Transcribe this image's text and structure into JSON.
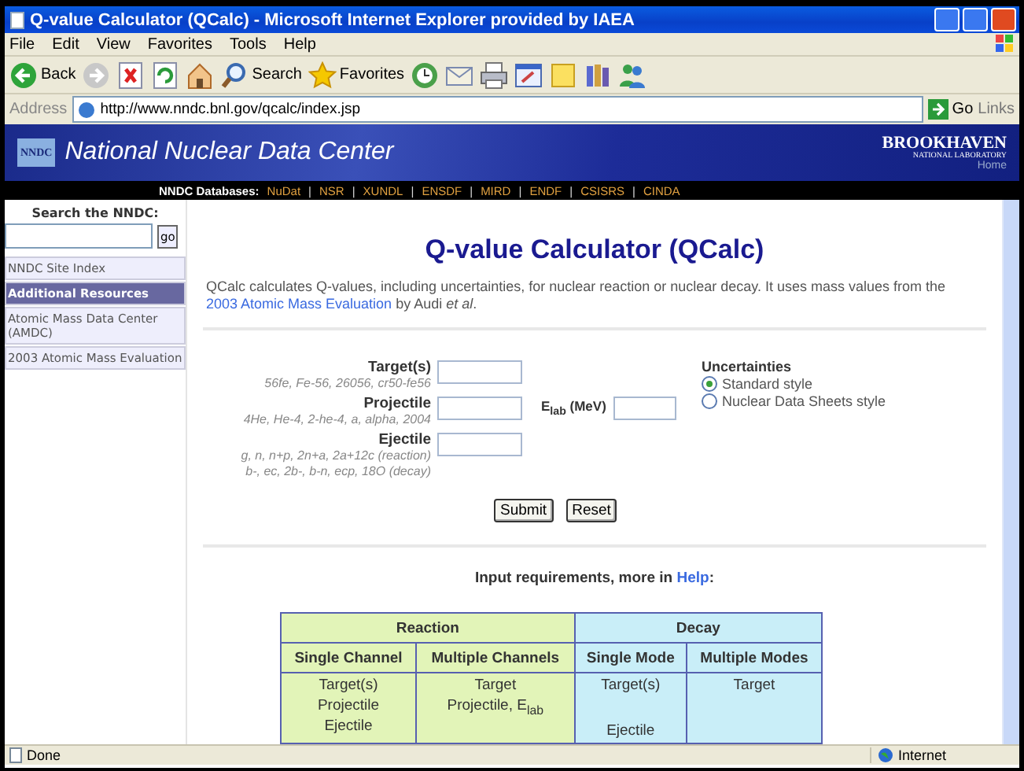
{
  "window": {
    "title": "Q-value Calculator (QCalc) - Microsoft Internet Explorer provided by IAEA",
    "menu": [
      "File",
      "Edit",
      "View",
      "Favorites",
      "Tools",
      "Help"
    ],
    "toolbar": [
      {
        "kind": "back",
        "label": "Back"
      },
      {
        "kind": "forward"
      },
      {
        "kind": "stop"
      },
      {
        "kind": "refresh"
      },
      {
        "kind": "home"
      },
      {
        "kind": "search",
        "label": "Search"
      },
      {
        "kind": "favorites",
        "label": "Favorites"
      },
      {
        "kind": "history"
      },
      {
        "kind": "mail"
      },
      {
        "kind": "print"
      },
      {
        "kind": "edit"
      },
      {
        "kind": "note"
      },
      {
        "kind": "research"
      },
      {
        "kind": "messenger"
      }
    ],
    "address": {
      "label": "Address",
      "url": "http://www.nndc.bnl.gov/qcalc/index.jsp",
      "go": "Go",
      "links": "Links"
    }
  },
  "header": {
    "logo": "NNDC",
    "title": "National Nuclear Data Center",
    "lab": "BROOKHAVEN",
    "lab_sub": "NATIONAL LABORATORY",
    "home": "Home"
  },
  "databases": {
    "label": "NNDC Databases:",
    "items": [
      {
        "kind": "link",
        "text": "NuDat"
      },
      {
        "kind": "separator",
        "text": "|"
      },
      {
        "kind": "link",
        "text": "NSR"
      },
      {
        "kind": "separator",
        "text": "|"
      },
      {
        "kind": "link",
        "text": "XUNDL"
      },
      {
        "kind": "separator",
        "text": "|"
      },
      {
        "kind": "link",
        "text": "ENSDF"
      },
      {
        "kind": "separator",
        "text": "|"
      },
      {
        "kind": "link",
        "text": "MIRD"
      },
      {
        "kind": "separator",
        "text": "|"
      },
      {
        "kind": "link",
        "text": "ENDF"
      },
      {
        "kind": "separator",
        "text": "|"
      },
      {
        "kind": "link",
        "text": "CSISRS"
      },
      {
        "kind": "separator",
        "text": "|"
      },
      {
        "kind": "link",
        "text": "CINDA"
      }
    ]
  },
  "sidebar": {
    "search_label": "Search the NNDC:",
    "go": "go",
    "items": [
      {
        "kind": "link",
        "label": "NNDC Site Index"
      },
      {
        "kind": "header",
        "label": "Additional Resources"
      },
      {
        "kind": "link",
        "label": "Atomic Mass Data Center (AMDC)"
      },
      {
        "kind": "link",
        "label": "2003 Atomic Mass Evaluation"
      }
    ]
  },
  "main": {
    "heading": "Q-value Calculator (QCalc)",
    "intro": {
      "before": "QCalc calculates Q-values, including uncertainties, for nuclear reaction or nuclear decay. It uses mass values from the ",
      "link": "2003 Atomic Mass Evaluation",
      "after": " by Audi *et al*."
    },
    "fields": [
      {
        "label": "Target(s)",
        "hints": [
          "56fe, Fe-56, 26056, cr50-fe56"
        ]
      },
      {
        "label": "Projectile",
        "hints": [
          "4He, He-4, 2-he-4, a, alpha, 2004"
        ]
      },
      {
        "label": "Ejectile",
        "hints": [
          "g, n, n+p, 2n+a, 2a+12c (reaction)",
          "b-, ec, 2b-, b-n, ecp, 18O (decay)"
        ]
      }
    ],
    "energy_label": "E$_{lab}$ (MeV)",
    "uncertainties": {
      "title": "Uncertainties",
      "options": [
        {
          "label": "Standard style",
          "selected": true
        },
        {
          "label": "Nuclear Data Sheets style",
          "selected": false
        }
      ]
    },
    "buttons": [
      "Submit",
      "Reset"
    ],
    "requirements": {
      "before": "Input requirements, more in ",
      "link": "Help",
      "after": ":"
    },
    "table": {
      "groups": [
        {
          "label": "Reaction",
          "color": "#e2f4b8",
          "columns": [
            {
              "header": "Single Channel",
              "lines": [
                "Target(s)",
                "Projectile",
                "Ejectile"
              ],
              "spread": false
            },
            {
              "header": "Multiple Channels",
              "lines": [
                "Target",
                "Projectile, E$_{lab}$"
              ],
              "spread": false
            }
          ]
        },
        {
          "label": "Decay",
          "color": "#c9eef8",
          "columns": [
            {
              "header": "Single Mode",
              "lines": [
                "Target(s)",
                "Ejectile"
              ],
              "spread": true
            },
            {
              "header": "Multiple Modes",
              "lines": [
                "Target"
              ],
              "spread": false
            }
          ]
        }
      ]
    }
  },
  "status": {
    "text": "Done",
    "zone": "Internet"
  }
}
